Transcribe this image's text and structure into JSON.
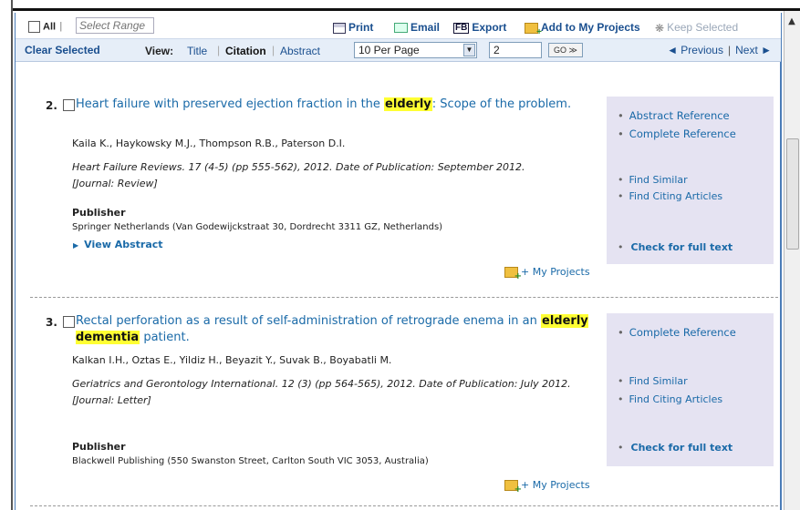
{
  "toolbar": {
    "all_label": "All",
    "range_placeholder": "Select Range",
    "print_label": "Print",
    "email_label": "Email",
    "export_label": "Export",
    "add_projects_label": "Add to My Projects",
    "keep_selected_label": "Keep Selected"
  },
  "viewbar": {
    "clear_selected": "Clear Selected",
    "view_label": "View:",
    "opt_title": "Title",
    "opt_citation": "Citation",
    "opt_abstract": "Abstract",
    "active_view": "Citation",
    "per_page_value": "10 Per Page",
    "page_value": "2",
    "go_label": "GO ≫",
    "previous": "◄ Previous",
    "next": "Next ►"
  },
  "records": [
    {
      "number": "2.",
      "title_before": "Heart failure with preserved ejection fraction in the ",
      "title_highlight": "elderly",
      "title_after": ": Scope of the problem.",
      "authors": "Kaila K., Haykowsky M.J., Thompson R.B., Paterson D.I.",
      "source": "Heart Failure Reviews. 17 (4-5) (pp 555-562), 2012. Date of Publication: September 2012.",
      "doc_type": "[Journal: Review]",
      "publisher_label": "Publisher",
      "publisher": "Springer Netherlands (Van Godewijckstraat 30, Dordrecht 3311 GZ, Netherlands)",
      "view_abstract": "View Abstract",
      "my_projects": "+ My Projects",
      "side": {
        "abstract_ref": "Abstract Reference",
        "complete_ref": "Complete Reference",
        "find_similar": "Find Similar",
        "find_citing": "Find Citing Articles",
        "full_text": "Check for full text"
      }
    },
    {
      "number": "3.",
      "title_before": "Rectal perforation as a result of self-administration of retrograde enema in an ",
      "title_highlight": "elderly dementia",
      "title_after": " patient.",
      "authors": "Kalkan I.H., Oztas E., Yildiz H., Beyazit Y., Suvak B., Boyabatli M.",
      "source": "Geriatrics and Gerontology International. 12 (3) (pp 564-565), 2012. Date of Publication: July 2012.",
      "doc_type": "[Journal: Letter]",
      "publisher_label": "Publisher",
      "publisher": "Blackwell Publishing (550 Swanston Street, Carlton South VIC 3053, Australia)",
      "my_projects": "+ My Projects",
      "side": {
        "complete_ref": "Complete Reference",
        "find_similar": "Find Similar",
        "find_citing": "Find Citing Articles",
        "full_text": "Check for full text"
      }
    }
  ],
  "colors": {
    "link": "#1a6aa8",
    "highlight": "#ffff33",
    "sidebar_bg": "#e5e3f2",
    "toolbar_bg": "#e6eef8"
  }
}
